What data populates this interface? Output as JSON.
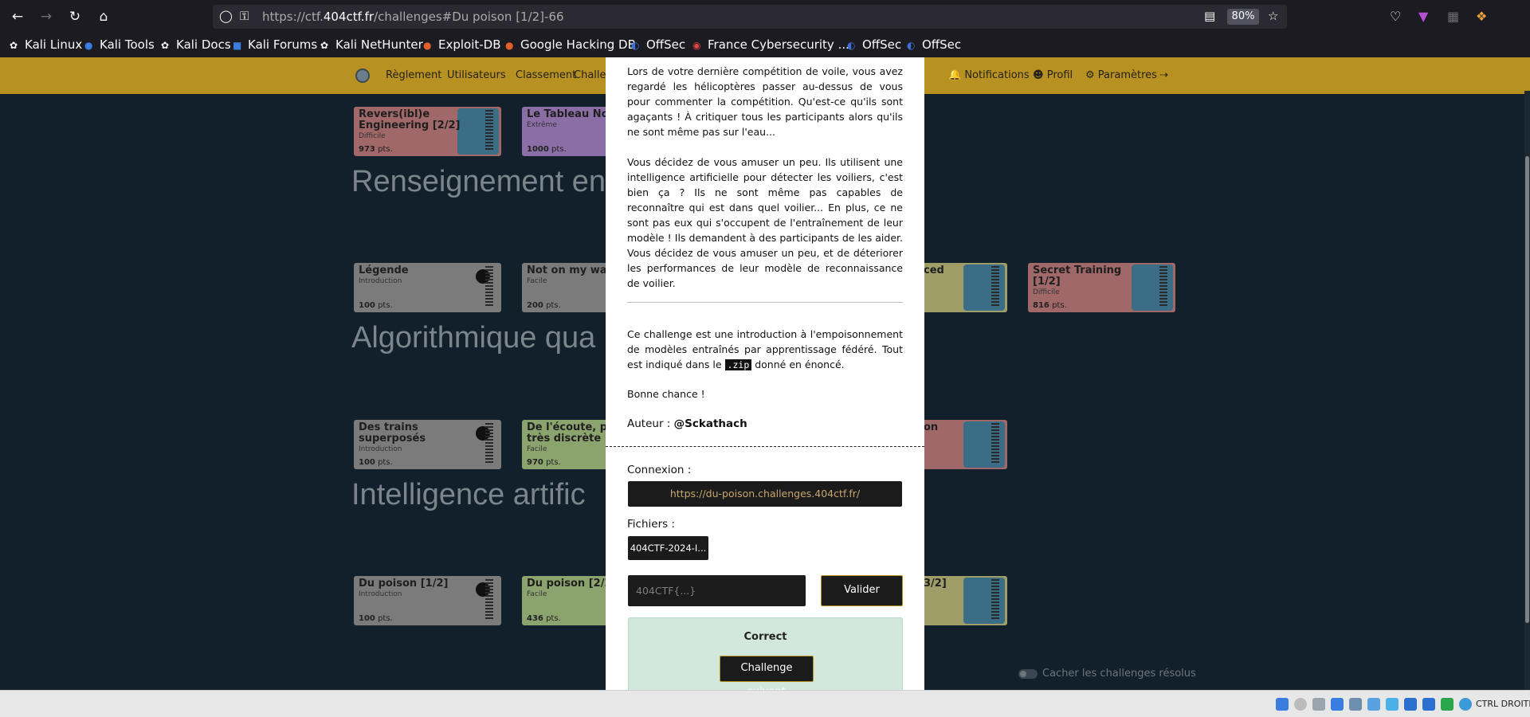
{
  "browser": {
    "url_prefix": "https://ctf.",
    "url_domain": "404ctf.fr",
    "url_path": "/challenges#Du poison [1/2]-66",
    "zoom": "80%"
  },
  "bookmarks": [
    {
      "label": "Kali Linux",
      "icon": "kali-dragon-icon"
    },
    {
      "label": "Kali Tools",
      "icon": "kali-tools-icon"
    },
    {
      "label": "Kali Docs",
      "icon": "kali-dragon-icon"
    },
    {
      "label": "Kali Forums",
      "icon": "kali-forums-icon"
    },
    {
      "label": "Kali NetHunter",
      "icon": "kali-dragon-icon"
    },
    {
      "label": "Exploit-DB",
      "icon": "exploit-db-icon"
    },
    {
      "label": "Google Hacking DB",
      "icon": "exploit-db-icon"
    },
    {
      "label": "OffSec",
      "icon": "offsec-icon"
    },
    {
      "label": "France Cybersecurity ...",
      "icon": "france-cyber-icon"
    },
    {
      "label": "OffSec",
      "icon": "offsec-icon"
    },
    {
      "label": "OffSec",
      "icon": "offsec-icon"
    }
  ],
  "nav": {
    "links": [
      "Règlement",
      "Utilisateurs",
      "Classement",
      "Challer"
    ],
    "notifications": "Notifications",
    "profile": "Profil",
    "settings": "Paramètres"
  },
  "sections": [
    {
      "title": "Renseignement en"
    },
    {
      "title": "Algorithmique qua"
    },
    {
      "title": "Intelligence artific"
    }
  ],
  "cards": {
    "row0": [
      {
        "title": "Revers(ibl)e Engineering [2/2]",
        "difficulty": "Difficile",
        "points": "973",
        "color": "#a06868"
      },
      {
        "title": "Le Tableau Noir",
        "difficulty": "Extrême",
        "points": "1000",
        "color": "#8b6ea6"
      }
    ],
    "row1": [
      {
        "title": "Légende",
        "difficulty": "Introduction",
        "points": "100",
        "color": "#7b7b7b"
      },
      {
        "title": "Not on my watc",
        "difficulty": "Facile",
        "points": "200",
        "color": "#7b7b7b"
      },
      {
        "title": "ced",
        "difficulty": "",
        "points": "",
        "color": "#a09e68"
      },
      {
        "title": "Secret Training [1/2]",
        "difficulty": "Difficile",
        "points": "816",
        "color": "#a06868"
      }
    ],
    "row2": [
      {
        "title": "Des trains superposés",
        "difficulty": "Introduction",
        "points": "100",
        "color": "#7b7b7b"
      },
      {
        "title": "De l'écoute, pas très discrète",
        "difficulty": "Facile",
        "points": "970",
        "color": "#8ba46e"
      },
      {
        "title": "on",
        "difficulty": "",
        "points": "",
        "color": "#a06868"
      }
    ],
    "row3": [
      {
        "title": "Du poison [1/2]",
        "difficulty": "Introduction",
        "points": "100",
        "color": "#7b7b7b"
      },
      {
        "title": "Du poison [2/2]",
        "difficulty": "Facile",
        "points": "436",
        "color": "#8ba46e"
      },
      {
        "title": "3/2]",
        "difficulty": "",
        "points": "",
        "color": "#a09e68"
      }
    ],
    "points_suffix": "pts."
  },
  "toggle_label": "Cacher les challenges résolus",
  "modal": {
    "desc1": "Lors de votre dernière compétition de voile, vous avez regardé les hélicoptères passer au-dessus de vous pour commenter la compétition. Qu'est-ce qu'ils sont agaçants ! À critiquer tous les participants alors qu'ils ne sont même pas sur l'eau...",
    "desc2": "Vous décidez de vous amuser un peu. Ils utilisent une intelligence artificielle pour détecter les voiliers, c'est bien ça ? Ils ne sont même pas capables de reconnaître qui est dans quel voilier... En plus, ce ne sont pas eux qui s'occupent de l'entraînement de leur modèle ! Ils demandent à des participants de les aider. Vous décidez de vous amuser un peu, et de déteriorer les performances de leur modèle de reconnaissance de voilier.",
    "desc3_before": "Ce challenge est une introduction à l'empoisonnement de modèles entraînés par apprentissage fédéré. Tout est indiqué dans le ",
    "desc3_code": ".zip",
    "desc3_after": " donné en énoncé.",
    "good_luck": "Bonne chance !",
    "author_label": "Auteur : ",
    "author": "@Sckathach",
    "connexion_label": "Connexion :",
    "connexion_url": "https://du-poison.challenges.404ctf.fr/",
    "files_label": "Fichiers :",
    "file_name": "404CTF-2024-I...",
    "flag_placeholder": "404CTF{...}",
    "submit_label": "Valider",
    "result": "Correct",
    "next_label": "Challenge suivant"
  },
  "taskbar": {
    "keyboard_hint": "CTRL DROITE"
  }
}
